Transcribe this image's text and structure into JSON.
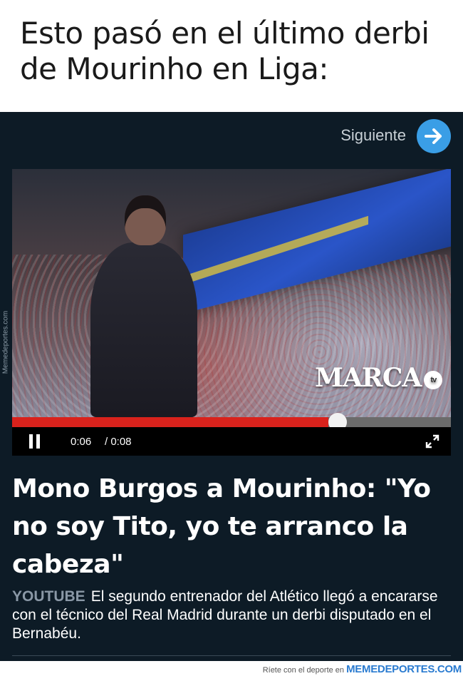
{
  "caption": {
    "line1": "Esto pasó en el último derbi",
    "line2": "de Mourinho en Liga:"
  },
  "card": {
    "next_label": "Siguiente",
    "video": {
      "logo_text": "MARCA",
      "logo_badge": "tv",
      "time_current": "0:06",
      "time_total": "/ 0:08",
      "progress_fraction": 0.8
    },
    "side_watermark": "Memedeportes.com",
    "headline": "Mono Burgos a Mourinho: \"Yo no soy Tito, yo te arranco la cabeza\"",
    "source": "YOUTUBE",
    "description": "El segundo entrenador del Atlético llegó a encararse con el técnico del Real Madrid durante un derbi disputado en el Bernabéu."
  },
  "footer": {
    "text": "Ríete con el deporte en",
    "brand": "MEMEDEPORTES.COM"
  },
  "colors": {
    "card_bg": "#0d1b26",
    "accent_blue": "#3a9ee6",
    "progress_red": "#d9221c"
  }
}
